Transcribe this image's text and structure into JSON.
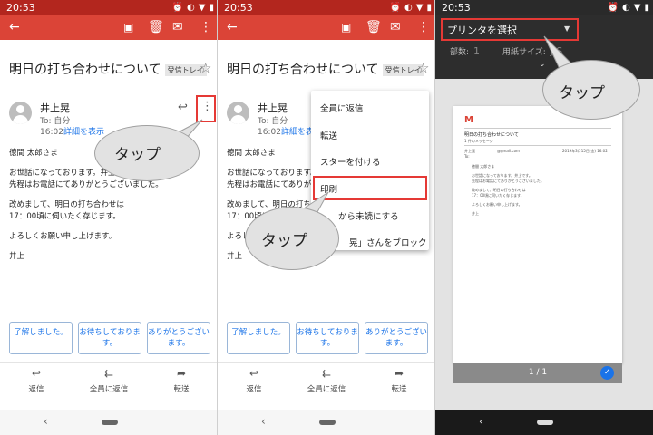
{
  "status": {
    "time": "20:53"
  },
  "email": {
    "subject": "明日の打ち合わせについて",
    "badge": "受信トレイ",
    "sender": "井上晃",
    "to": "To: 自分",
    "time": "16:02",
    "details_link": "詳細を表示",
    "body_p1": [
      "徳間 太郎さま"
    ],
    "body_p2": [
      "お世話になっております。井上です。",
      "先程はお電話にてありがとうございました。"
    ],
    "body_p3": [
      "改めまして、明日の打ち合わせは",
      "17：00頃に伺いたく存じます。"
    ],
    "body_p4": [
      "よろしくお願い申し上げます。"
    ],
    "body_p5": [
      "井上"
    ]
  },
  "smart_replies": [
    "了解しました。",
    "お待ちしております。",
    "ありがとうございます。"
  ],
  "actions": {
    "reply": "返信",
    "reply_all": "全員に返信",
    "forward": "転送"
  },
  "menu": {
    "items": [
      "全員に返信",
      "転送",
      "スターを付ける",
      "印刷",
      "ここから未読にする",
      "「井上晃」さんをブロック"
    ],
    "visible": [
      "全員に返信",
      "転送",
      "スターを付ける",
      "印刷",
      "から未読にする",
      "晃」さんをブロック"
    ]
  },
  "callout": "タップ",
  "print": {
    "printer": "プリンタを選択",
    "copies_label": "部数:",
    "copies_value": "1",
    "paper_label": "用紙サイズ:",
    "paper_value": "JIS",
    "page_count": "1 / 1"
  },
  "preview": {
    "logo": "M",
    "title": "明日の打ち合わせについて",
    "subtitle": "1 件のメッセージ",
    "sender": "井上晃",
    "to": "To:",
    "address": "@gmail.com",
    "date": "2019年3月15日(金) 16:02",
    "lines": [
      "徳間 太郎さま",
      "お世話になっております。井上です。",
      "先程はお電話にてありがとうございました。",
      "改めまして、明日の打ち合わせは",
      "17：00頃に伺いたく存じます。",
      "よろしくお願い申し上げます。",
      "井上"
    ]
  },
  "colors": {
    "gmail_red": "#db4437",
    "status_red": "#b3261e",
    "highlight": "#e53935",
    "link": "#1a73e8"
  },
  "icons": [
    "back-arrow-icon",
    "archive-icon",
    "trash-icon",
    "mail-icon",
    "more-vert-icon",
    "star-icon",
    "reply-icon",
    "reply-all-icon",
    "forward-icon",
    "check-icon",
    "chevron-down-icon"
  ]
}
